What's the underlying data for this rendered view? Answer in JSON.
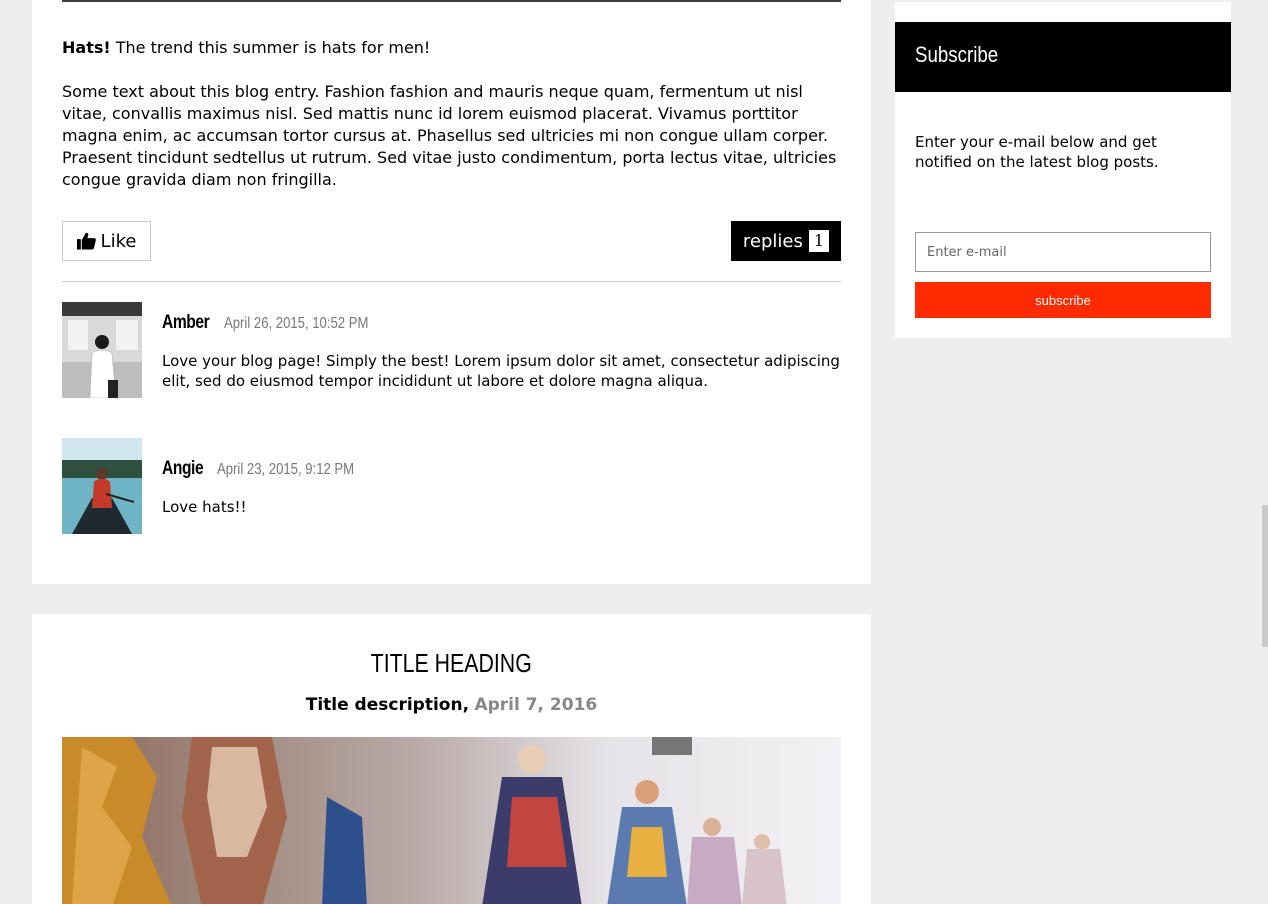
{
  "post1": {
    "lead_bold": "Hats!",
    "lead_rest": "The trend this summer is hats for men!",
    "body": "Some text about this blog entry. Fashion fashion and mauris neque quam, fermentum ut nisl vitae, convallis maximus nisl. Sed mattis nunc id lorem euismod placerat. Vivamus porttitor magna enim, ac accumsan tortor cursus at. Phasellus sed ultricies mi non congue ullam corper. Praesent tincidunt sedtellus ut rutrum. Sed vitae justo condimentum, porta lectus vitae, ultricies congue gravida diam non fringilla.",
    "like_label": "Like",
    "like_icon": "thumbs-up-icon",
    "replies_label": "replies",
    "replies_count": "1"
  },
  "comments": [
    {
      "name": "Amber",
      "date": "April 26, 2015, 10:52 PM",
      "text": "Love your blog page! Simply the best! Lorem ipsum dolor sit amet, consectetur adipiscing elit, sed do eiusmod tempor incididunt ut labore et dolore magna aliqua."
    },
    {
      "name": "Angie",
      "date": "April 23, 2015, 9:12 PM",
      "text": "Love hats!!"
    }
  ],
  "post2": {
    "title": "TITLE HEADING",
    "description": "Title description,",
    "date": "April 7, 2016"
  },
  "subscribe": {
    "title": "Subscribe",
    "text": "Enter your e-mail below and get notified on the latest blog posts.",
    "input_placeholder": "Enter e-mail",
    "button_label": "subscribe",
    "button_color": "#ff2a00",
    "header_color": "#000000"
  }
}
